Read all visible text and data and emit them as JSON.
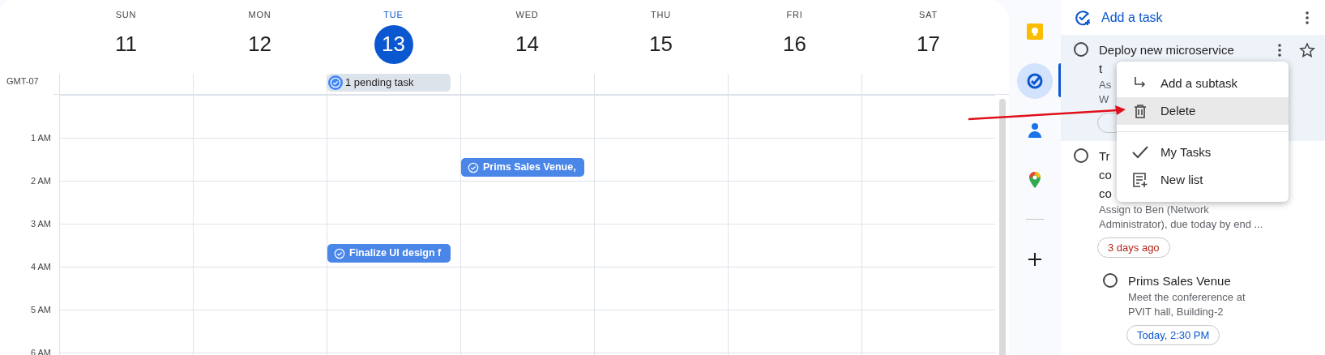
{
  "calendar": {
    "timezone": "GMT-07",
    "days": [
      {
        "weekday": "SUN",
        "date": "11",
        "selected": false
      },
      {
        "weekday": "MON",
        "date": "12",
        "selected": false
      },
      {
        "weekday": "TUE",
        "date": "13",
        "selected": true,
        "pending_chip": "1 pending task"
      },
      {
        "weekday": "WED",
        "date": "14",
        "selected": false
      },
      {
        "weekday": "THU",
        "date": "15",
        "selected": false
      },
      {
        "weekday": "FRI",
        "date": "16",
        "selected": false
      },
      {
        "weekday": "SAT",
        "date": "17",
        "selected": false
      }
    ],
    "rows": [
      {
        "cells": [
          {
            "kind": "slot"
          },
          {
            "kind": "slot"
          },
          {
            "kind": "slot"
          },
          {
            "kind": "slot"
          },
          {
            "kind": "slot"
          },
          {
            "kind": "slot"
          },
          {
            "kind": "slot"
          }
        ]
      },
      {
        "label": "1 AM",
        "cells": [
          {
            "kind": "slot"
          },
          {
            "kind": "slot"
          },
          {
            "kind": "slot"
          },
          {
            "kind": "event",
            "title": "Prims Sales Venue,"
          },
          {
            "kind": "slot"
          },
          {
            "kind": "slot"
          },
          {
            "kind": "slot"
          }
        ]
      },
      {
        "label": "2 AM",
        "cells": [
          {
            "kind": "slot"
          },
          {
            "kind": "slot"
          },
          {
            "kind": "slot"
          },
          {
            "kind": "slot"
          },
          {
            "kind": "slot"
          },
          {
            "kind": "slot"
          },
          {
            "kind": "slot"
          }
        ]
      },
      {
        "label": "3 AM",
        "cells": [
          {
            "kind": "slot"
          },
          {
            "kind": "slot"
          },
          {
            "kind": "event",
            "title": "Finalize UI design f"
          },
          {
            "kind": "slot"
          },
          {
            "kind": "slot"
          },
          {
            "kind": "slot"
          },
          {
            "kind": "slot"
          }
        ]
      },
      {
        "label": "4 AM",
        "cells": [
          {
            "kind": "slot"
          },
          {
            "kind": "slot"
          },
          {
            "kind": "slot"
          },
          {
            "kind": "slot"
          },
          {
            "kind": "slot"
          },
          {
            "kind": "slot"
          },
          {
            "kind": "slot"
          }
        ]
      },
      {
        "label": "5 AM",
        "cells": [
          {
            "kind": "slot"
          },
          {
            "kind": "slot"
          },
          {
            "kind": "slot"
          },
          {
            "kind": "slot"
          },
          {
            "kind": "slot"
          },
          {
            "kind": "slot"
          },
          {
            "kind": "slot"
          }
        ]
      },
      {
        "label": "6 AM",
        "cells": [
          {
            "kind": "slot"
          },
          {
            "kind": "slot"
          },
          {
            "kind": "slot"
          },
          {
            "kind": "slot"
          },
          {
            "kind": "slot"
          },
          {
            "kind": "slot"
          },
          {
            "kind": "slot"
          }
        ]
      }
    ]
  },
  "rail": [
    {
      "kind": "keep",
      "selected": false
    },
    {
      "kind": "tasks",
      "selected": true
    },
    {
      "kind": "contacts",
      "selected": false
    },
    {
      "kind": "maps",
      "selected": false
    },
    {
      "kind": "add",
      "selected": false
    }
  ],
  "tasks_panel": {
    "add_label": "Add a task",
    "tasks": [
      {
        "selected": true,
        "title_lines": [
          "Deploy new microservice",
          "t"
        ],
        "details_lines": [
          "As",
          "W"
        ],
        "chip": {
          "kind": "overdue"
        }
      },
      {
        "selected": false,
        "title_lines": [
          "Tr",
          "co",
          "co"
        ],
        "details_lines": [
          "Assign to Ben (Network",
          "Administrator), due today by end ..."
        ],
        "chip": {
          "kind": "overdue",
          "text": "3 days ago"
        },
        "children": [
          {
            "selected": false,
            "title_lines": [
              "Prims Sales Venue"
            ],
            "details_lines": [
              "Meet the confererence at",
              "PVIT hall, Building-2"
            ],
            "chip": {
              "kind": "today",
              "text": "Today, 2:30 PM"
            }
          }
        ]
      }
    ]
  },
  "context_menu": {
    "groups": [
      [
        {
          "label": "Add a subtask",
          "kind": "subtask",
          "selected": false
        },
        {
          "label": "Delete",
          "kind": "delete",
          "selected": true
        }
      ],
      [
        {
          "label": "My Tasks",
          "kind": "list",
          "checked": true,
          "selected": false
        },
        {
          "label": "New list",
          "kind": "new-list",
          "selected": false
        }
      ]
    ]
  }
}
